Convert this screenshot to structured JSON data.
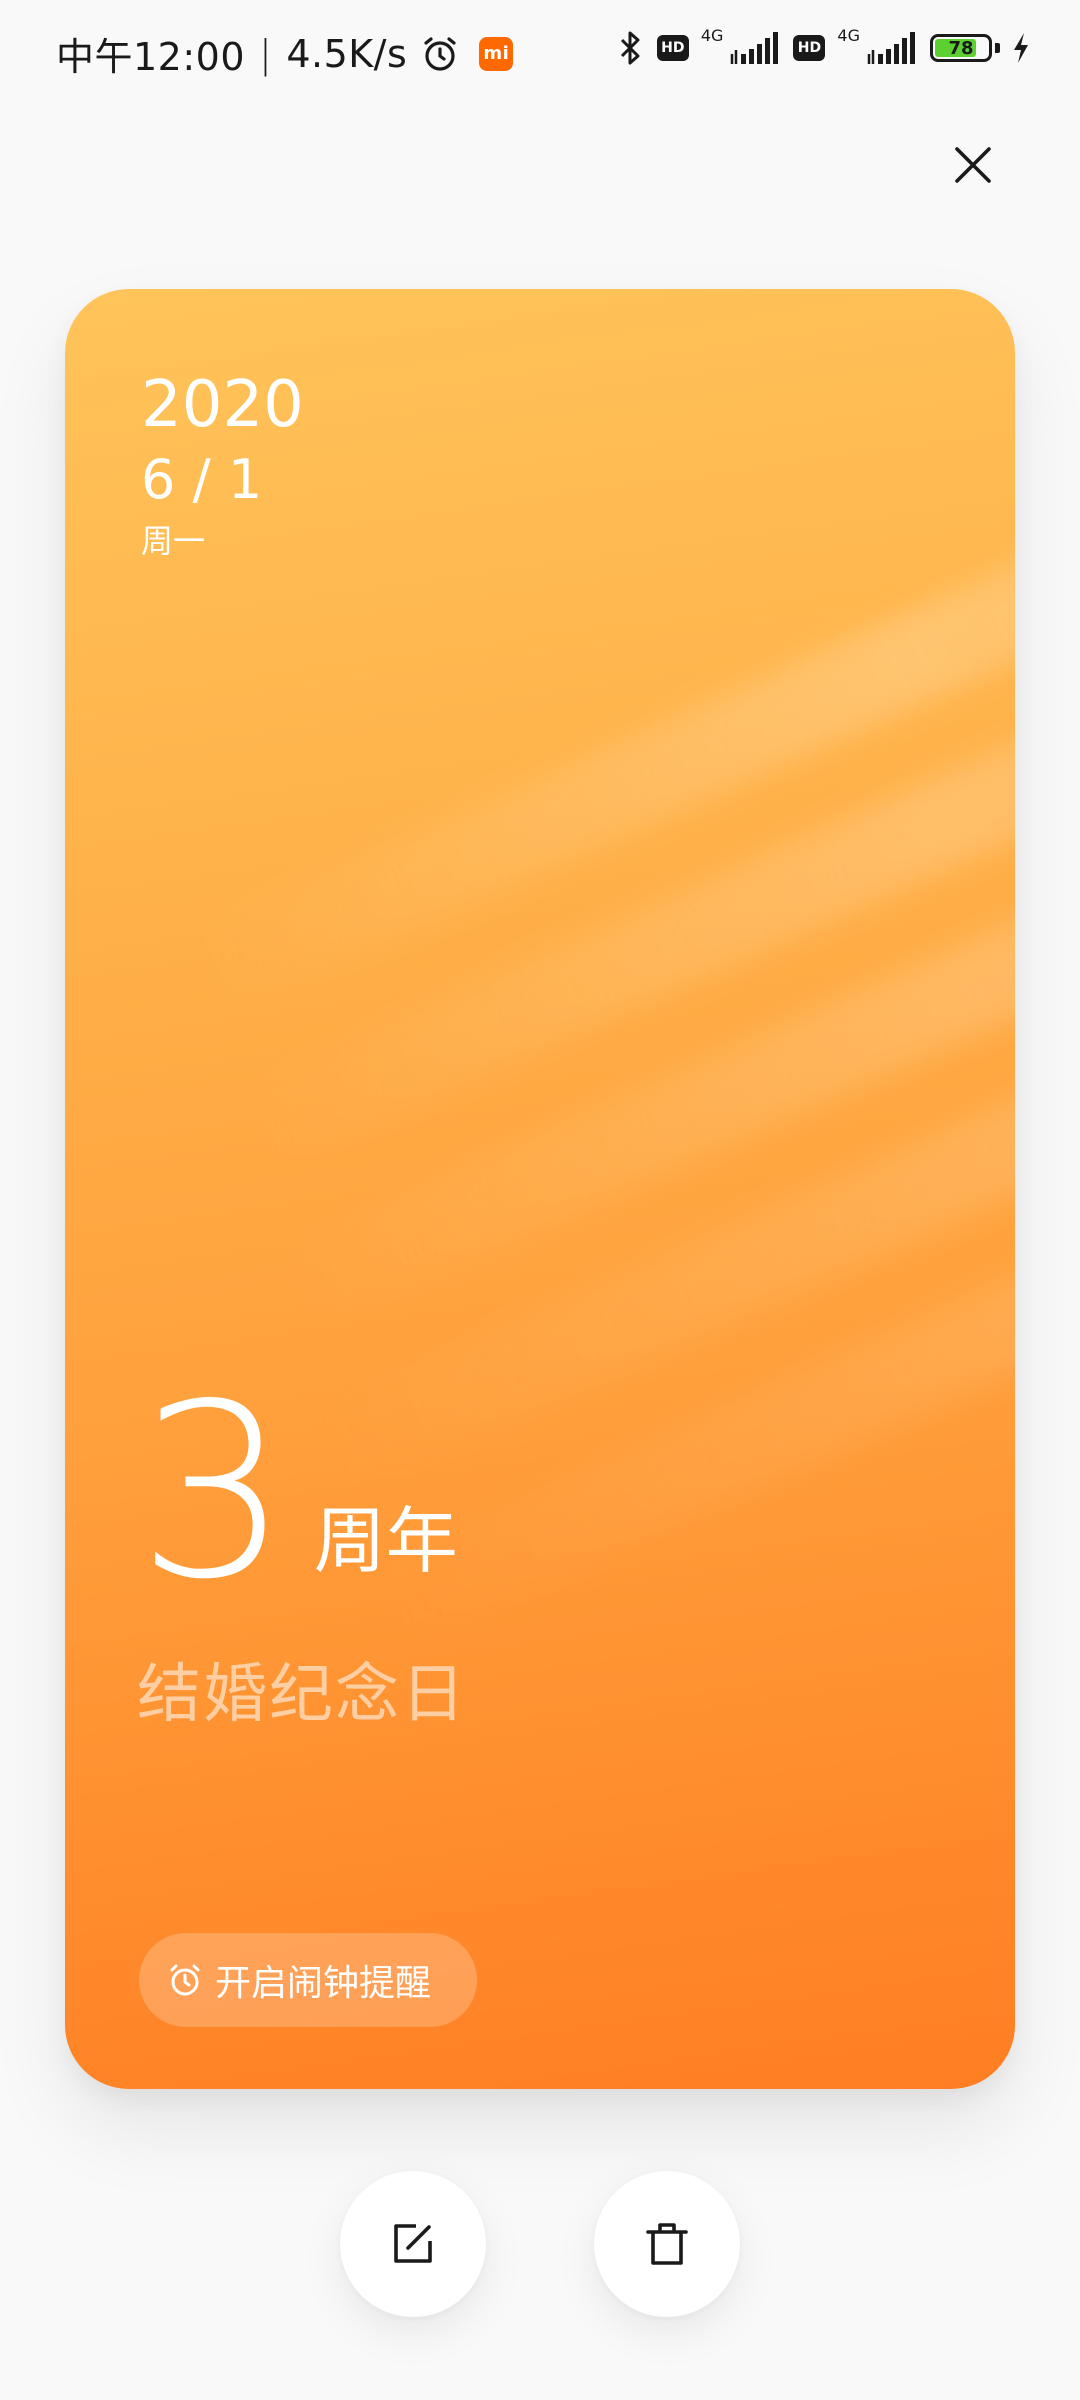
{
  "status_bar": {
    "time": "中午12:00",
    "separator": "|",
    "network_speed": "4.5K/s",
    "mi_badge": "mi",
    "hd_1": "HD",
    "net_1": "4G",
    "hd_2": "HD",
    "net_2": "4G",
    "battery_level": "78",
    "battery_fraction": 0.78,
    "icons": [
      "alarm-icon",
      "bluetooth-icon",
      "signal-icon",
      "charging-icon"
    ]
  },
  "card": {
    "year": "2020",
    "month_day": "6 / 1",
    "weekday": "周一",
    "count": "3",
    "unit": "周年",
    "title": "结婚纪念日",
    "alarm_label": "开启闹钟提醒",
    "accent_top": "#ffc45a",
    "accent_bottom": "#ff7e22"
  },
  "actions": {
    "icons": [
      "close-icon",
      "edit-icon",
      "delete-icon"
    ]
  }
}
